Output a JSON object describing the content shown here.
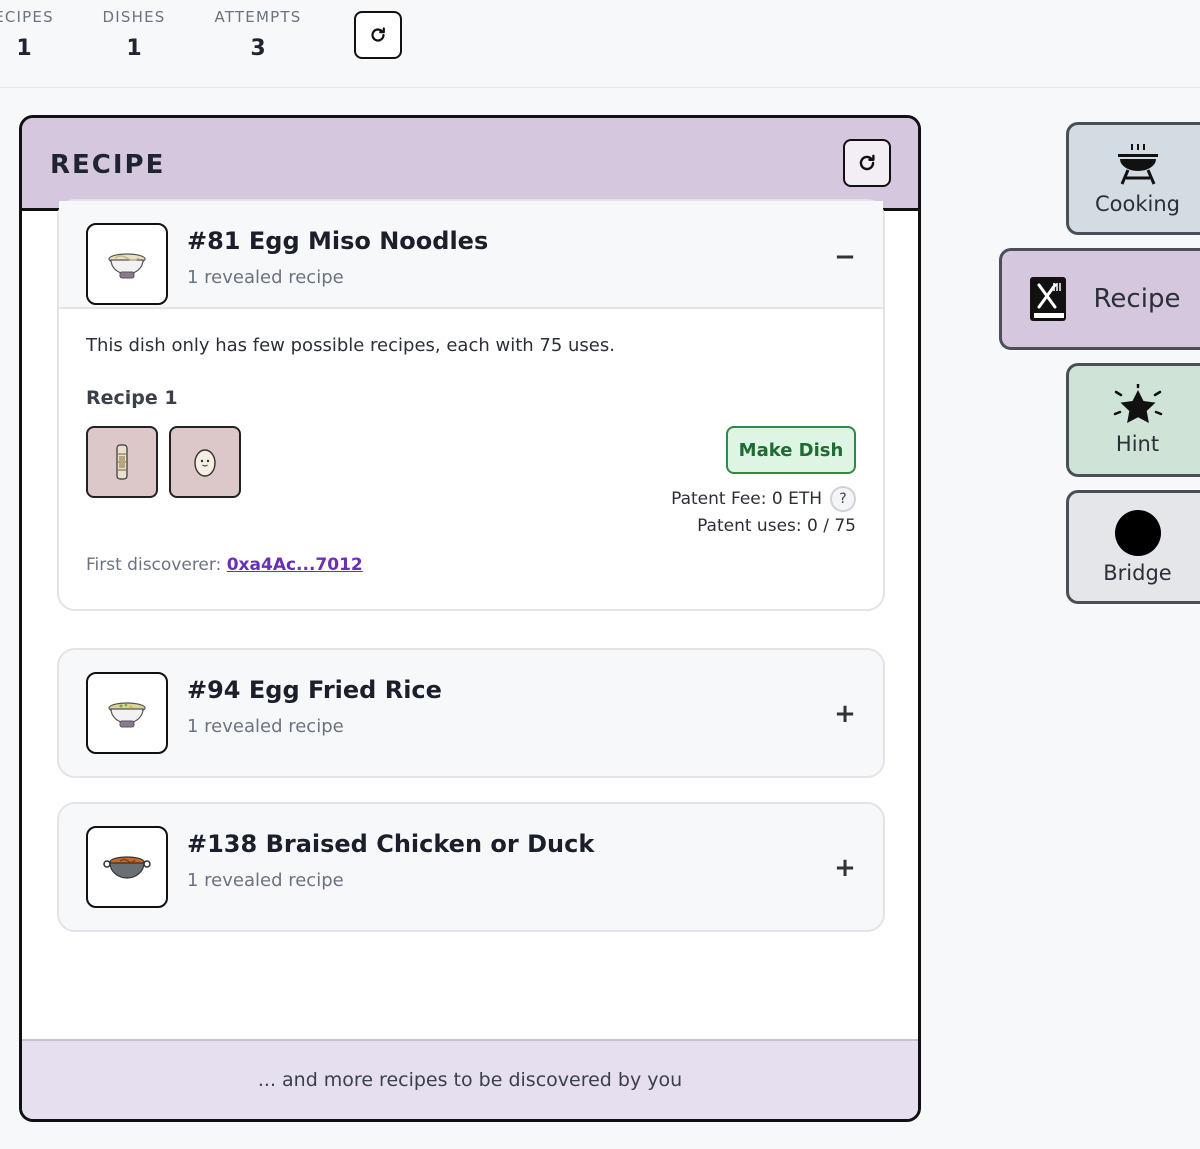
{
  "stats": {
    "recipes": {
      "label": "ECIPES",
      "value": "1"
    },
    "dishes": {
      "label": "DISHES",
      "value": "1"
    },
    "attempts": {
      "label": "ATTEMPTS",
      "value": "3"
    }
  },
  "panel": {
    "title": "RECIPE",
    "footer": "... and more recipes to be discovered by you",
    "dishes": [
      {
        "title": "#81 Egg Miso Noodles",
        "subtitle": "1 revealed recipe",
        "toggle": "−",
        "expanded": true,
        "description": "This dish only has few possible recipes, each with 75 uses.",
        "recipe_label": "Recipe 1",
        "make_button": "Make Dish",
        "patent_fee": "Patent Fee: 0 ETH",
        "help": "?",
        "patent_uses": "Patent uses: 0 / 75",
        "discoverer_label": "First discoverer:",
        "discoverer_address": "0xa4Ac...7012"
      },
      {
        "title": "#94 Egg Fried Rice",
        "subtitle": "1 revealed recipe",
        "toggle": "+"
      },
      {
        "title": "#138 Braised Chicken or Duck",
        "subtitle": "1 revealed recipe",
        "toggle": "+"
      }
    ]
  },
  "sidebar": {
    "cooking": "Cooking",
    "recipe": "Recipe",
    "hint": "Hint",
    "bridge": "Bridge"
  },
  "icons": {
    "refresh": "refresh-icon",
    "bowl": "bowl-icon",
    "pot": "pot-icon",
    "stick": "cinnamon-stick-icon",
    "egg": "egg-icon",
    "grill": "grill-icon",
    "recipe_book": "recipe-book-icon",
    "star": "star-icon",
    "bridge": "circle-icon"
  }
}
